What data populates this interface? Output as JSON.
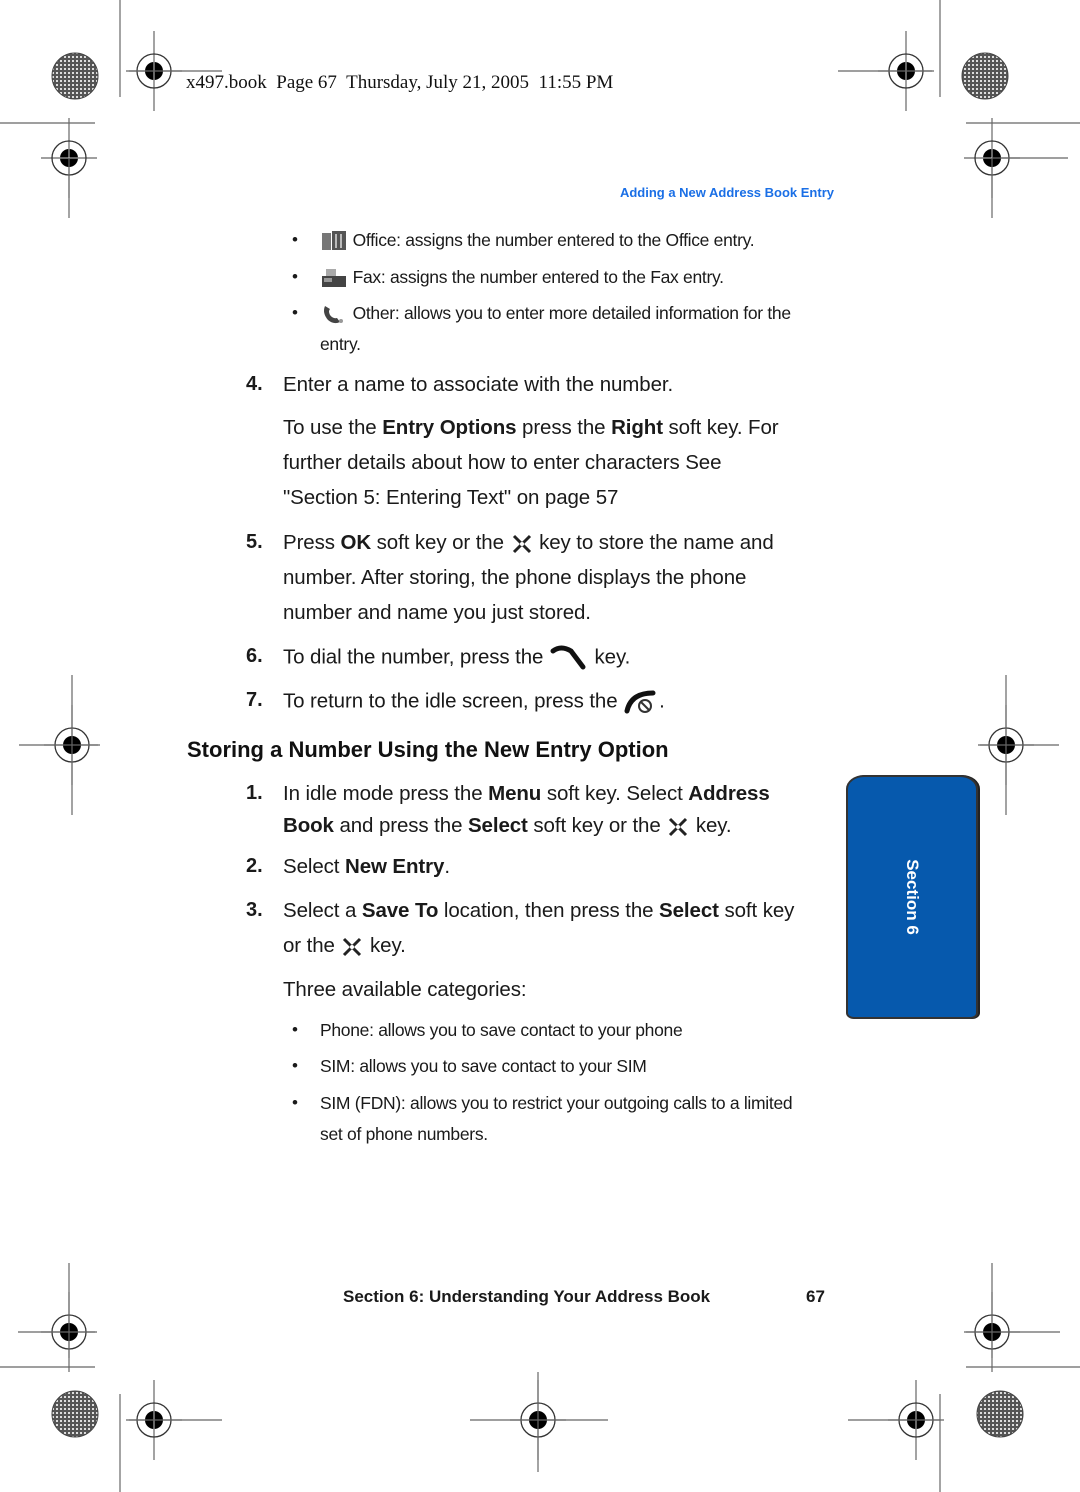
{
  "header": {
    "book_line": "x497.book  Page 67  Thursday, July 21, 2005  11:55 PM",
    "running_head": "Adding a New Address Book Entry"
  },
  "top_bullets": [
    {
      "icon": "office-icon",
      "text": "Office: assigns the number entered to the Office entry."
    },
    {
      "icon": "fax-icon",
      "text": "Fax: assigns the number entered to the Fax entry."
    },
    {
      "icon": "other-phone-icon",
      "text": "Other: allows you to enter more detailed information for the",
      "text2": "entry."
    }
  ],
  "steps_a": [
    {
      "num": "4.",
      "line1": "Enter a name to associate with the number.",
      "p1_pre": "To use the ",
      "p1_b1": "Entry Options",
      "p1_mid": " press the ",
      "p1_b2": "Right",
      "p1_post": " soft key. For",
      "p2": "further details about how to enter characters See",
      "p3": "\"Section 5: Entering Text\" on page 57"
    },
    {
      "num": "5.",
      "pre": "Press ",
      "bold": "OK",
      "mid": " soft key or the ",
      "post": " key to store the name and",
      "l2": "number. After storing, the phone displays the phone",
      "l3": "number and name you just stored."
    },
    {
      "num": "6.",
      "pre": "To dial the number, press the ",
      "post": " key."
    },
    {
      "num": "7.",
      "pre": "To return to the idle screen, press the ",
      "post": "."
    }
  ],
  "section_heading": "Storing a Number Using the New Entry Option",
  "steps_b": [
    {
      "num": "1.",
      "pre": "In idle mode press the ",
      "b1": "Menu",
      "mid": " soft key. Select ",
      "b2": "Address",
      "l2_b": "Book",
      "l2_mid": " and press the ",
      "l2_b2": "Select",
      "l2_post": " soft key or the ",
      "l2_end": " key."
    },
    {
      "num": "2.",
      "pre": "Select ",
      "b1": "New Entry",
      "post": "."
    },
    {
      "num": "3.",
      "pre": "Select a ",
      "b1": "Save To",
      "mid": " location, then press the ",
      "b2": "Select",
      "post": " soft key",
      "l2_pre": "or the ",
      "l2_post": " key."
    }
  ],
  "categories_intro": "Three available categories:",
  "category_bullets": [
    "Phone: allows you to save contact to your phone",
    "SIM: allows you to save contact to your SIM",
    "SIM (FDN): allows you to restrict your outgoing calls to a limited",
    "set of phone numbers."
  ],
  "side_tab": {
    "label": "Section 6",
    "color": "#0659ad"
  },
  "footer": {
    "title": "Section 6: Understanding Your Address Book",
    "page": "67"
  },
  "colors": {
    "running_head": "#1a6fe6",
    "tab": "#0659ad"
  }
}
